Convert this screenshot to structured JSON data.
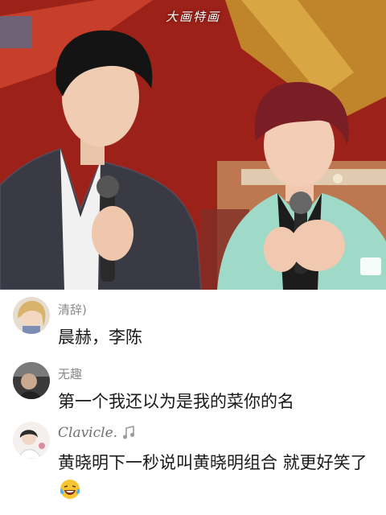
{
  "video": {
    "watermark": "大画特画"
  },
  "comments": [
    {
      "username": "清辞)",
      "text": "晨赫，李陈",
      "avatar_icon": "avatar-blonde-icon"
    },
    {
      "username": "无趣",
      "text": "第一个我还以为是我的菜你的名",
      "avatar_icon": "avatar-dark-icon"
    },
    {
      "username": "Clavicle.",
      "text": "黄晓明下一秒说叫黄晓明组合 就更好笑了",
      "emoji": "laughing-tears-emoji",
      "avatar_icon": "avatar-portrait-icon"
    }
  ],
  "colors": {
    "username": "#8a8a8a",
    "comment_text": "#1a1a1a",
    "stage_red": "#a8261d"
  }
}
